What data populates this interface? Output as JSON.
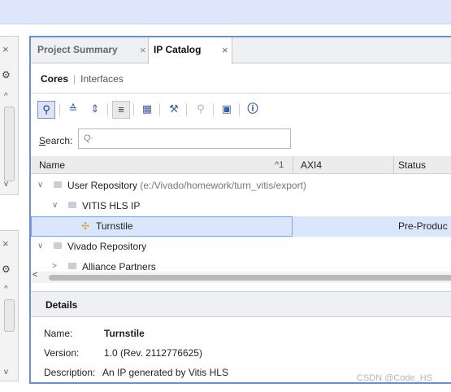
{
  "tabs": {
    "project_summary": "Project Summary",
    "ip_catalog": "IP Catalog",
    "close_glyph": "×"
  },
  "subtabs": {
    "cores": "Cores",
    "separator": "|",
    "interfaces": "Interfaces"
  },
  "search": {
    "label_prefix": "S",
    "label_rest": "earch:",
    "placeholder": "Q·"
  },
  "table": {
    "headers": {
      "name": "Name",
      "sort_marker": "^1",
      "axi4": "AXI4",
      "status": "Status"
    },
    "rows": {
      "user_repo": {
        "name": "User Repository",
        "path": "(e:/Vivado/homework/turn_vitis/export)"
      },
      "vitis_hls_ip": {
        "name": "VITIS HLS IP"
      },
      "turnstile": {
        "name": "Turnstile",
        "status": "Pre-Produc"
      },
      "vivado_repo": {
        "name": "Vivado Repository"
      },
      "alliance": {
        "name": "Alliance Partners"
      }
    }
  },
  "details": {
    "title": "Details",
    "name_label": "Name:",
    "name_value": "Turnstile",
    "version_label": "Version:",
    "version_value": "1.0 (Rev. 2112776625)",
    "description_label": "Description:",
    "description_value": "An IP generated by Vitis HLS"
  },
  "watermark": "CSDN @Code_HS",
  "colors": {
    "accent": "#6a8fd8",
    "top_band": "#dde6fb",
    "selection": "#d9e6fb"
  },
  "icons": [
    "search-icon",
    "collapse-all-icon",
    "expand-icon",
    "filter-icon",
    "hierarchy-icon",
    "wrench-icon",
    "key-icon",
    "chip-icon",
    "info-icon",
    "gear-icon",
    "close-icon",
    "folder-icon",
    "ip-core-icon"
  ]
}
